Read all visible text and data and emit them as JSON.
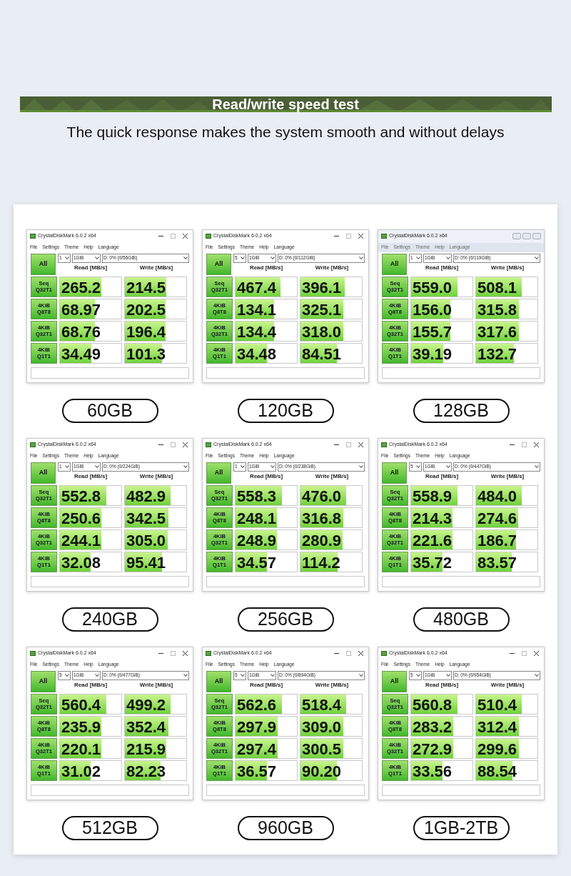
{
  "header": {
    "title": "Read/write speed test",
    "subtitle": "The quick response makes the system smooth and without delays"
  },
  "panels": [
    {
      "kind": "modern",
      "title": "CrystalDiskMark 6.0.2 x64",
      "menu": [
        "File",
        "Settings",
        "Theme",
        "Help",
        "Language"
      ],
      "all_button": "All",
      "count": "1",
      "size": "1GiB",
      "drive": "D: 0% (0/56GiB)",
      "read_header": "Read [MB/s]",
      "write_header": "Write [MB/s]",
      "capacity": "60GB",
      "tests": [
        {
          "line1": "Seq",
          "line2": "Q32T1",
          "read": {
            "value": "265.2",
            "level": 0.68
          },
          "write": {
            "value": "214.5",
            "level": 0.67
          }
        },
        {
          "line1": "4KiB",
          "line2": "Q8T8",
          "read": {
            "value": "68.97",
            "level": 0.57
          },
          "write": {
            "value": "202.5",
            "level": 0.66
          }
        },
        {
          "line1": "4KiB",
          "line2": "Q32T1",
          "read": {
            "value": "68.76",
            "level": 0.57
          },
          "write": {
            "value": "196.4",
            "level": 0.66
          }
        },
        {
          "line1": "4KiB",
          "line2": "Q1T1",
          "read": {
            "value": "34.49",
            "level": 0.51
          },
          "write": {
            "value": "101.3",
            "level": 0.6
          }
        }
      ]
    },
    {
      "kind": "modern",
      "title": "CrystalDiskMark 6.0.2 x64",
      "menu": [
        "File",
        "Settings",
        "Theme",
        "Help",
        "Language"
      ],
      "all_button": "All",
      "count": "5",
      "size": "1GiB",
      "drive": "D: 0% (0/112GiB)",
      "read_header": "Read [MB/s]",
      "write_header": "Write [MB/s]",
      "capacity": "120GB",
      "tests": [
        {
          "line1": "Seq",
          "line2": "Q32T1",
          "read": {
            "value": "467.4",
            "level": 0.73
          },
          "write": {
            "value": "396.1",
            "level": 0.72
          }
        },
        {
          "line1": "4KiB",
          "line2": "Q8T8",
          "read": {
            "value": "134.1",
            "level": 0.63
          },
          "write": {
            "value": "325.1",
            "level": 0.7
          }
        },
        {
          "line1": "4KiB",
          "line2": "Q32T1",
          "read": {
            "value": "134.4",
            "level": 0.63
          },
          "write": {
            "value": "318.0",
            "level": 0.7
          }
        },
        {
          "line1": "4KiB",
          "line2": "Q1T1",
          "read": {
            "value": "34.48",
            "level": 0.51
          },
          "write": {
            "value": "84.51",
            "level": 0.59
          }
        }
      ]
    },
    {
      "kind": "classic",
      "title": "CrystalDiskMark 6.0.2 x64",
      "menu": [
        "File",
        "Settings",
        "Theme",
        "Help",
        "Language"
      ],
      "all_button": "All",
      "count": "1",
      "size": "1GiB",
      "drive": "D: 0% (0/119GiB)",
      "read_header": "Read [MB/s]",
      "write_header": "Write [MB/s]",
      "capacity": "128GB",
      "tests": [
        {
          "line1": "Seq",
          "line2": "Q32T1",
          "read": {
            "value": "559.0",
            "level": 0.75
          },
          "write": {
            "value": "508.1",
            "level": 0.74
          }
        },
        {
          "line1": "4KiB",
          "line2": "Q8T8",
          "read": {
            "value": "156.0",
            "level": 0.64
          },
          "write": {
            "value": "315.8",
            "level": 0.7
          }
        },
        {
          "line1": "4KiB",
          "line2": "Q32T1",
          "read": {
            "value": "155.7",
            "level": 0.64
          },
          "write": {
            "value": "317.6",
            "level": 0.7
          }
        },
        {
          "line1": "4KiB",
          "line2": "Q1T1",
          "read": {
            "value": "39.19",
            "level": 0.52
          },
          "write": {
            "value": "132.7",
            "level": 0.62
          }
        }
      ]
    },
    {
      "kind": "modern",
      "title": "CrystalDiskMark 6.0.2 x64",
      "menu": [
        "File",
        "Settings",
        "Theme",
        "Help",
        "Language"
      ],
      "all_button": "All",
      "count": "1",
      "size": "1GiB",
      "drive": "D: 0% (0/224GiB)",
      "read_header": "Read [MB/s]",
      "write_header": "Write [MB/s]",
      "capacity": "240GB",
      "tests": [
        {
          "line1": "Seq",
          "line2": "Q32T1",
          "read": {
            "value": "552.8",
            "level": 0.75
          },
          "write": {
            "value": "482.9",
            "level": 0.74
          }
        },
        {
          "line1": "4KiB",
          "line2": "Q8T8",
          "read": {
            "value": "250.6",
            "level": 0.68
          },
          "write": {
            "value": "342.5",
            "level": 0.71
          }
        },
        {
          "line1": "4KiB",
          "line2": "Q32T1",
          "read": {
            "value": "244.1",
            "level": 0.68
          },
          "write": {
            "value": "305.0",
            "level": 0.7
          }
        },
        {
          "line1": "4KiB",
          "line2": "Q1T1",
          "read": {
            "value": "32.08",
            "level": 0.5
          },
          "write": {
            "value": "95.41",
            "level": 0.6
          }
        }
      ]
    },
    {
      "kind": "modern",
      "title": "CrystalDiskMark 6.0.2 x64",
      "menu": [
        "File",
        "Settings",
        "Theme",
        "Help",
        "Language"
      ],
      "all_button": "All",
      "count": "1",
      "size": "1GiB",
      "drive": "D: 0% (0/238GiB)",
      "read_header": "Read [MB/s]",
      "write_header": "Write [MB/s]",
      "capacity": "256GB",
      "tests": [
        {
          "line1": "Seq",
          "line2": "Q32T1",
          "read": {
            "value": "558.3",
            "level": 0.75
          },
          "write": {
            "value": "476.0",
            "level": 0.74
          }
        },
        {
          "line1": "4KiB",
          "line2": "Q8T8",
          "read": {
            "value": "248.1",
            "level": 0.68
          },
          "write": {
            "value": "316.8",
            "level": 0.7
          }
        },
        {
          "line1": "4KiB",
          "line2": "Q32T1",
          "read": {
            "value": "248.9",
            "level": 0.68
          },
          "write": {
            "value": "280.9",
            "level": 0.69
          }
        },
        {
          "line1": "4KiB",
          "line2": "Q1T1",
          "read": {
            "value": "34.57",
            "level": 0.51
          },
          "write": {
            "value": "114.2",
            "level": 0.61
          }
        }
      ]
    },
    {
      "kind": "modern",
      "title": "CrystalDiskMark 6.0.2 x64",
      "menu": [
        "File",
        "Settings",
        "Theme",
        "Help",
        "Language"
      ],
      "all_button": "All",
      "count": "5",
      "size": "1GiB",
      "drive": "D: 0% (0/447GiB)",
      "read_header": "Read [MB/s]",
      "write_header": "Write [MB/s]",
      "capacity": "480GB",
      "tests": [
        {
          "line1": "Seq",
          "line2": "Q32T1",
          "read": {
            "value": "558.9",
            "level": 0.75
          },
          "write": {
            "value": "484.0",
            "level": 0.74
          }
        },
        {
          "line1": "4KiB",
          "line2": "Q8T8",
          "read": {
            "value": "214.3",
            "level": 0.67
          },
          "write": {
            "value": "274.6",
            "level": 0.69
          }
        },
        {
          "line1": "4KiB",
          "line2": "Q32T1",
          "read": {
            "value": "221.6",
            "level": 0.67
          },
          "write": {
            "value": "186.7",
            "level": 0.65
          }
        },
        {
          "line1": "4KiB",
          "line2": "Q1T1",
          "read": {
            "value": "35.72",
            "level": 0.51
          },
          "write": {
            "value": "83.57",
            "level": 0.58
          }
        }
      ]
    },
    {
      "kind": "modern",
      "title": "CrystalDiskMark 6.0.2 x64",
      "menu": [
        "File",
        "Settings",
        "Theme",
        "Help",
        "Language"
      ],
      "all_button": "All",
      "count": "5",
      "size": "1GiB",
      "drive": "D: 0% (0/477GiB)",
      "read_header": "Read [MB/s]",
      "write_header": "Write [MB/s]",
      "capacity": "512GB",
      "tests": [
        {
          "line1": "Seq",
          "line2": "Q32T1",
          "read": {
            "value": "560.4",
            "level": 0.75
          },
          "write": {
            "value": "499.2",
            "level": 0.74
          }
        },
        {
          "line1": "4KiB",
          "line2": "Q8T8",
          "read": {
            "value": "235.9",
            "level": 0.67
          },
          "write": {
            "value": "352.4",
            "level": 0.71
          }
        },
        {
          "line1": "4KiB",
          "line2": "Q32T1",
          "read": {
            "value": "220.1",
            "level": 0.67
          },
          "write": {
            "value": "215.9",
            "level": 0.67
          }
        },
        {
          "line1": "4KiB",
          "line2": "Q1T1",
          "read": {
            "value": "31.02",
            "level": 0.5
          },
          "write": {
            "value": "82.23",
            "level": 0.58
          }
        }
      ]
    },
    {
      "kind": "modern",
      "title": "CrystalDiskMark 6.0.2 x64",
      "menu": [
        "File",
        "Settings",
        "Theme",
        "Help",
        "Language"
      ],
      "all_button": "All",
      "count": "5",
      "size": "1GiB",
      "drive": "D: 0% (0/894GiB)",
      "read_header": "Read [MB/s]",
      "write_header": "Write [MB/s]",
      "capacity": "960GB",
      "tests": [
        {
          "line1": "Seq",
          "line2": "Q32T1",
          "read": {
            "value": "562.6",
            "level": 0.75
          },
          "write": {
            "value": "518.4",
            "level": 0.74
          }
        },
        {
          "line1": "4KiB",
          "line2": "Q8T8",
          "read": {
            "value": "297.9",
            "level": 0.69
          },
          "write": {
            "value": "309.0",
            "level": 0.7
          }
        },
        {
          "line1": "4KiB",
          "line2": "Q32T1",
          "read": {
            "value": "297.4",
            "level": 0.69
          },
          "write": {
            "value": "300.5",
            "level": 0.7
          }
        },
        {
          "line1": "4KiB",
          "line2": "Q1T1",
          "read": {
            "value": "36.57",
            "level": 0.51
          },
          "write": {
            "value": "90.20",
            "level": 0.59
          }
        }
      ]
    },
    {
      "kind": "modern",
      "title": "CrystalDiskMark 6.0.2 x64",
      "menu": [
        "File",
        "Settings",
        "Theme",
        "Help",
        "Language"
      ],
      "all_button": "All",
      "count": "5",
      "size": "1GiB",
      "drive": "D: 0% (0/954GiB)",
      "read_header": "Read [MB/s]",
      "write_header": "Write [MB/s]",
      "capacity": "1GB-2TB",
      "tests": [
        {
          "line1": "Seq",
          "line2": "Q32T1",
          "read": {
            "value": "560.8",
            "level": 0.75
          },
          "write": {
            "value": "510.4",
            "level": 0.74
          }
        },
        {
          "line1": "4KiB",
          "line2": "Q8T8",
          "read": {
            "value": "283.2",
            "level": 0.69
          },
          "write": {
            "value": "312.4",
            "level": 0.7
          }
        },
        {
          "line1": "4KiB",
          "line2": "Q32T1",
          "read": {
            "value": "272.9",
            "level": 0.69
          },
          "write": {
            "value": "299.6",
            "level": 0.7
          }
        },
        {
          "line1": "4KiB",
          "line2": "Q1T1",
          "read": {
            "value": "33.56",
            "level": 0.51
          },
          "write": {
            "value": "88.54",
            "level": 0.59
          }
        }
      ]
    }
  ]
}
